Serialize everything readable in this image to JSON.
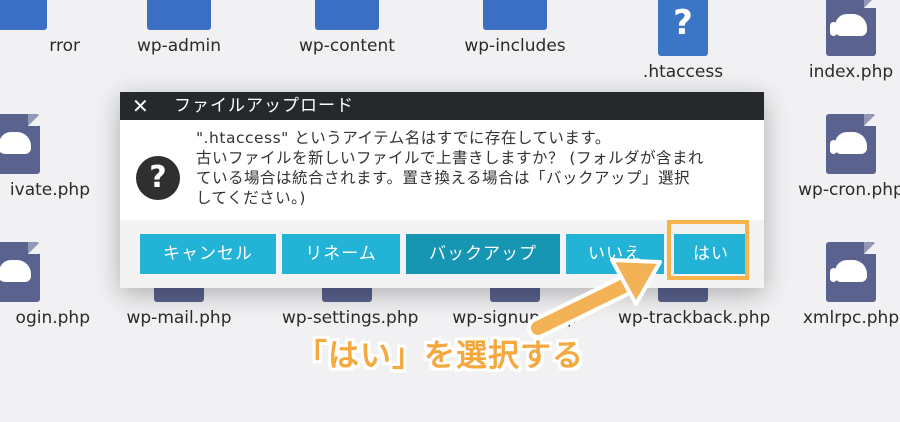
{
  "files": [
    {
      "name": "rror",
      "type": "folder"
    },
    {
      "name": "wp-admin",
      "type": "folder"
    },
    {
      "name": "wp-content",
      "type": "folder"
    },
    {
      "name": "wp-includes",
      "type": "folder"
    },
    {
      "name": ".htaccess",
      "type": "unknown"
    },
    {
      "name": "index.php",
      "type": "php"
    },
    {
      "name": "ivate.php",
      "type": "php"
    },
    {
      "name": "wp-cron.php",
      "type": "php"
    },
    {
      "name": "ogin.php",
      "type": "php"
    },
    {
      "name": "wp-mail.php",
      "type": "php"
    },
    {
      "name": "wp-settings.php",
      "type": "php"
    },
    {
      "name": "wp-signup.php",
      "type": "php"
    },
    {
      "name": "wp-trackback.php",
      "type": "php"
    },
    {
      "name": "xmlrpc.php",
      "type": "php"
    }
  ],
  "dialog": {
    "title": "ファイルアップロード",
    "close_glyph": "✕",
    "question_glyph": "?",
    "message_lines": [
      "\".htaccess\" というアイテム名はすでに存在しています。",
      "古いファイルを新しいファイルで上書きしますか？ (フォルダが含まれ",
      "ている場合は統合されます。置き換える場合は「バックアップ」選択",
      "してください。)"
    ],
    "buttons": {
      "cancel": "キャンセル",
      "rename": "リネーム",
      "backup": "バックアップ",
      "no": "いいえ",
      "yes": "はい"
    }
  },
  "annotation": "「はい」を選択する",
  "colors": {
    "button": "#23b3d6",
    "button_active": "#1796b4",
    "highlight": "#f7b24c",
    "titlebar": "#25292b"
  }
}
